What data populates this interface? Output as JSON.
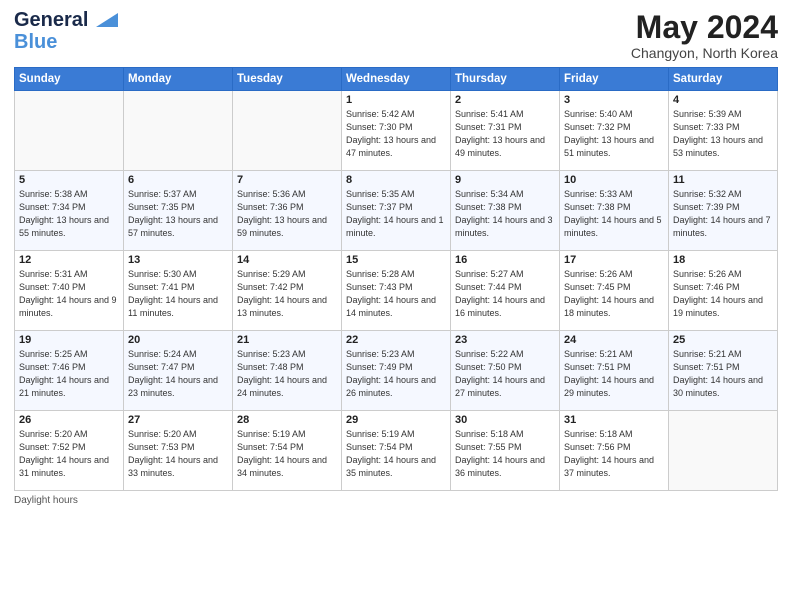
{
  "header": {
    "logo_line1": "General",
    "logo_line2": "Blue",
    "month_title": "May 2024",
    "location": "Changyon, North Korea"
  },
  "days_of_week": [
    "Sunday",
    "Monday",
    "Tuesday",
    "Wednesday",
    "Thursday",
    "Friday",
    "Saturday"
  ],
  "weeks": [
    [
      {
        "day": "",
        "sunrise": "",
        "sunset": "",
        "daylight": ""
      },
      {
        "day": "",
        "sunrise": "",
        "sunset": "",
        "daylight": ""
      },
      {
        "day": "",
        "sunrise": "",
        "sunset": "",
        "daylight": ""
      },
      {
        "day": "1",
        "sunrise": "Sunrise: 5:42 AM",
        "sunset": "Sunset: 7:30 PM",
        "daylight": "Daylight: 13 hours and 47 minutes."
      },
      {
        "day": "2",
        "sunrise": "Sunrise: 5:41 AM",
        "sunset": "Sunset: 7:31 PM",
        "daylight": "Daylight: 13 hours and 49 minutes."
      },
      {
        "day": "3",
        "sunrise": "Sunrise: 5:40 AM",
        "sunset": "Sunset: 7:32 PM",
        "daylight": "Daylight: 13 hours and 51 minutes."
      },
      {
        "day": "4",
        "sunrise": "Sunrise: 5:39 AM",
        "sunset": "Sunset: 7:33 PM",
        "daylight": "Daylight: 13 hours and 53 minutes."
      }
    ],
    [
      {
        "day": "5",
        "sunrise": "Sunrise: 5:38 AM",
        "sunset": "Sunset: 7:34 PM",
        "daylight": "Daylight: 13 hours and 55 minutes."
      },
      {
        "day": "6",
        "sunrise": "Sunrise: 5:37 AM",
        "sunset": "Sunset: 7:35 PM",
        "daylight": "Daylight: 13 hours and 57 minutes."
      },
      {
        "day": "7",
        "sunrise": "Sunrise: 5:36 AM",
        "sunset": "Sunset: 7:36 PM",
        "daylight": "Daylight: 13 hours and 59 minutes."
      },
      {
        "day": "8",
        "sunrise": "Sunrise: 5:35 AM",
        "sunset": "Sunset: 7:37 PM",
        "daylight": "Daylight: 14 hours and 1 minute."
      },
      {
        "day": "9",
        "sunrise": "Sunrise: 5:34 AM",
        "sunset": "Sunset: 7:38 PM",
        "daylight": "Daylight: 14 hours and 3 minutes."
      },
      {
        "day": "10",
        "sunrise": "Sunrise: 5:33 AM",
        "sunset": "Sunset: 7:38 PM",
        "daylight": "Daylight: 14 hours and 5 minutes."
      },
      {
        "day": "11",
        "sunrise": "Sunrise: 5:32 AM",
        "sunset": "Sunset: 7:39 PM",
        "daylight": "Daylight: 14 hours and 7 minutes."
      }
    ],
    [
      {
        "day": "12",
        "sunrise": "Sunrise: 5:31 AM",
        "sunset": "Sunset: 7:40 PM",
        "daylight": "Daylight: 14 hours and 9 minutes."
      },
      {
        "day": "13",
        "sunrise": "Sunrise: 5:30 AM",
        "sunset": "Sunset: 7:41 PM",
        "daylight": "Daylight: 14 hours and 11 minutes."
      },
      {
        "day": "14",
        "sunrise": "Sunrise: 5:29 AM",
        "sunset": "Sunset: 7:42 PM",
        "daylight": "Daylight: 14 hours and 13 minutes."
      },
      {
        "day": "15",
        "sunrise": "Sunrise: 5:28 AM",
        "sunset": "Sunset: 7:43 PM",
        "daylight": "Daylight: 14 hours and 14 minutes."
      },
      {
        "day": "16",
        "sunrise": "Sunrise: 5:27 AM",
        "sunset": "Sunset: 7:44 PM",
        "daylight": "Daylight: 14 hours and 16 minutes."
      },
      {
        "day": "17",
        "sunrise": "Sunrise: 5:26 AM",
        "sunset": "Sunset: 7:45 PM",
        "daylight": "Daylight: 14 hours and 18 minutes."
      },
      {
        "day": "18",
        "sunrise": "Sunrise: 5:26 AM",
        "sunset": "Sunset: 7:46 PM",
        "daylight": "Daylight: 14 hours and 19 minutes."
      }
    ],
    [
      {
        "day": "19",
        "sunrise": "Sunrise: 5:25 AM",
        "sunset": "Sunset: 7:46 PM",
        "daylight": "Daylight: 14 hours and 21 minutes."
      },
      {
        "day": "20",
        "sunrise": "Sunrise: 5:24 AM",
        "sunset": "Sunset: 7:47 PM",
        "daylight": "Daylight: 14 hours and 23 minutes."
      },
      {
        "day": "21",
        "sunrise": "Sunrise: 5:23 AM",
        "sunset": "Sunset: 7:48 PM",
        "daylight": "Daylight: 14 hours and 24 minutes."
      },
      {
        "day": "22",
        "sunrise": "Sunrise: 5:23 AM",
        "sunset": "Sunset: 7:49 PM",
        "daylight": "Daylight: 14 hours and 26 minutes."
      },
      {
        "day": "23",
        "sunrise": "Sunrise: 5:22 AM",
        "sunset": "Sunset: 7:50 PM",
        "daylight": "Daylight: 14 hours and 27 minutes."
      },
      {
        "day": "24",
        "sunrise": "Sunrise: 5:21 AM",
        "sunset": "Sunset: 7:51 PM",
        "daylight": "Daylight: 14 hours and 29 minutes."
      },
      {
        "day": "25",
        "sunrise": "Sunrise: 5:21 AM",
        "sunset": "Sunset: 7:51 PM",
        "daylight": "Daylight: 14 hours and 30 minutes."
      }
    ],
    [
      {
        "day": "26",
        "sunrise": "Sunrise: 5:20 AM",
        "sunset": "Sunset: 7:52 PM",
        "daylight": "Daylight: 14 hours and 31 minutes."
      },
      {
        "day": "27",
        "sunrise": "Sunrise: 5:20 AM",
        "sunset": "Sunset: 7:53 PM",
        "daylight": "Daylight: 14 hours and 33 minutes."
      },
      {
        "day": "28",
        "sunrise": "Sunrise: 5:19 AM",
        "sunset": "Sunset: 7:54 PM",
        "daylight": "Daylight: 14 hours and 34 minutes."
      },
      {
        "day": "29",
        "sunrise": "Sunrise: 5:19 AM",
        "sunset": "Sunset: 7:54 PM",
        "daylight": "Daylight: 14 hours and 35 minutes."
      },
      {
        "day": "30",
        "sunrise": "Sunrise: 5:18 AM",
        "sunset": "Sunset: 7:55 PM",
        "daylight": "Daylight: 14 hours and 36 minutes."
      },
      {
        "day": "31",
        "sunrise": "Sunrise: 5:18 AM",
        "sunset": "Sunset: 7:56 PM",
        "daylight": "Daylight: 14 hours and 37 minutes."
      },
      {
        "day": "",
        "sunrise": "",
        "sunset": "",
        "daylight": ""
      }
    ]
  ],
  "footer": {
    "daylight_label": "Daylight hours"
  }
}
